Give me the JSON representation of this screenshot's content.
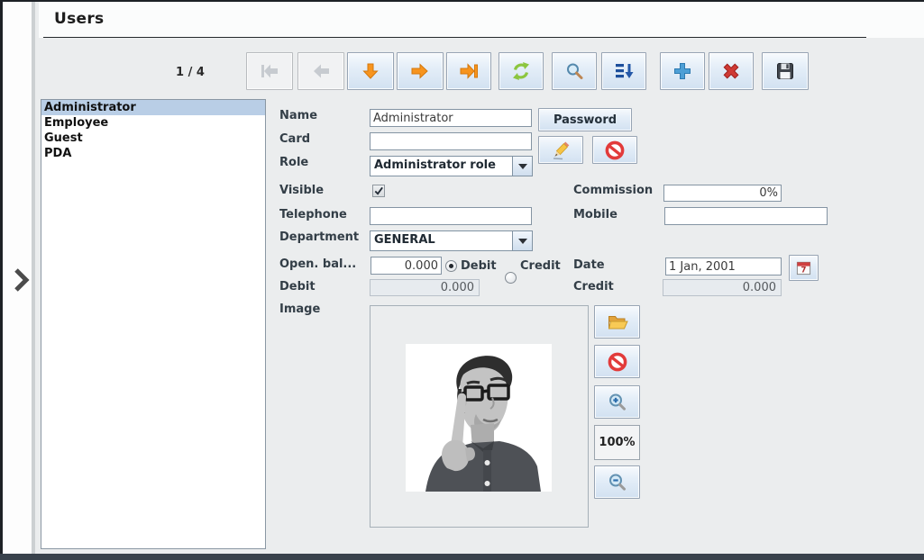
{
  "window": {
    "title": "Users"
  },
  "toolbar": {
    "record_counter": "1 / 4",
    "icons": [
      "first-record",
      "previous-record",
      "move-down",
      "next-record",
      "last-record",
      "refresh",
      "search",
      "sort",
      "add-record",
      "delete-record",
      "save-record"
    ]
  },
  "user_list": {
    "items": [
      "Administrator",
      "Employee",
      "Guest",
      "PDA"
    ],
    "selected": "Administrator"
  },
  "form": {
    "name": {
      "label": "Name",
      "value": "Administrator"
    },
    "password_button_label": "Password",
    "card": {
      "label": "Card",
      "value": ""
    },
    "role": {
      "label": "Role",
      "value": "Administrator role"
    },
    "visible": {
      "label": "Visible",
      "checked": true
    },
    "commission": {
      "label": "Commission",
      "value": "0%"
    },
    "telephone": {
      "label": "Telephone",
      "value": ""
    },
    "mobile": {
      "label": "Mobile",
      "value": ""
    },
    "department": {
      "label": "Department",
      "value": "GENERAL"
    },
    "open_balance": {
      "label": "Open. bal...",
      "value": "0.000"
    },
    "balance_type": {
      "options": [
        "Debit",
        "Credit"
      ],
      "selected": "Debit"
    },
    "date": {
      "label": "Date",
      "value": "1 Jan, 2001"
    },
    "debit_total": {
      "label": "Debit",
      "value": "0.000"
    },
    "credit_total": {
      "label": "Credit",
      "value": "0.000"
    },
    "image": {
      "label": "Image",
      "zoom_level": "100%"
    }
  },
  "colors": {
    "selection": "#b9cee6",
    "nav_arrow_orange": "#f7941e",
    "disabled_arrow": "#c7cbd0",
    "refresh_green": "#8cc63f",
    "sort_blue": "#1d4f9c",
    "add_blue": "#4d9fd6",
    "delete_red": "#cf3a34",
    "content_bg": "#ebedee",
    "frame_dark": "#39424c"
  }
}
